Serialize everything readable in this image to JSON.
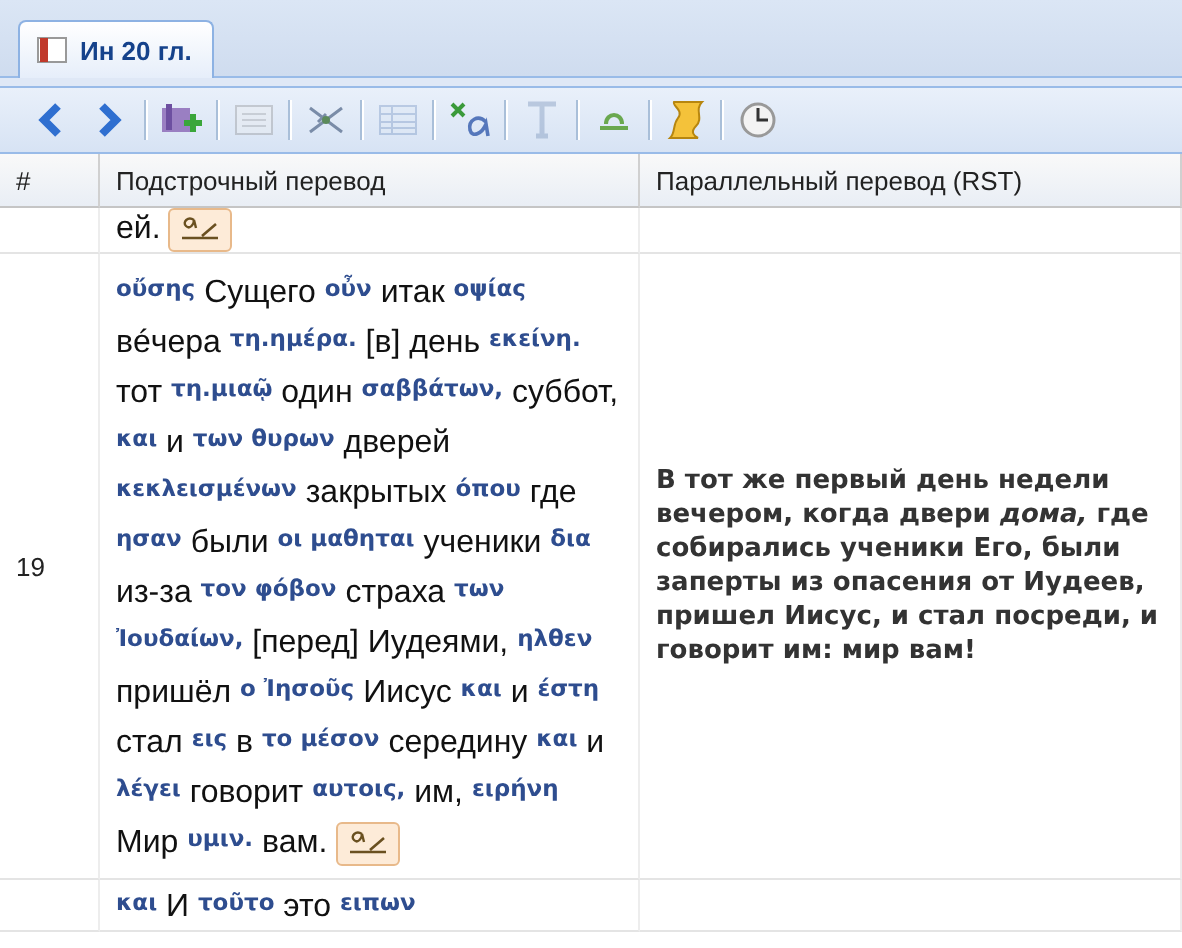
{
  "tabs": [
    {
      "label": "Ин 20 гл.",
      "selected": true
    }
  ],
  "toolbar": [
    {
      "kind": "back",
      "disabled": false
    },
    {
      "kind": "forward",
      "disabled": false
    },
    {
      "kind": "separator"
    },
    {
      "kind": "book-add",
      "disabled": false
    },
    {
      "kind": "separator"
    },
    {
      "kind": "page",
      "disabled": true
    },
    {
      "kind": "separator"
    },
    {
      "kind": "graph",
      "disabled": false
    },
    {
      "kind": "separator"
    },
    {
      "kind": "table",
      "disabled": true
    },
    {
      "kind": "separator"
    },
    {
      "kind": "alpha",
      "disabled": false
    },
    {
      "kind": "separator"
    },
    {
      "kind": "text",
      "disabled": true
    },
    {
      "kind": "separator"
    },
    {
      "kind": "arc",
      "disabled": false
    },
    {
      "kind": "separator"
    },
    {
      "kind": "scroll",
      "disabled": false
    },
    {
      "kind": "separator"
    },
    {
      "kind": "clock",
      "disabled": false
    }
  ],
  "table": {
    "columns": [
      "#",
      "Подстрочный перевод",
      "Параллельный перевод (RST)"
    ],
    "rows": [
      {
        "number": "",
        "tokens": [
          {
            "kind": "russian",
            "text": "ей."
          }
        ],
        "note_icon": true,
        "parallel": ""
      },
      {
        "number": "19",
        "tokens": [
          {
            "kind": "greek",
            "text": "οὔσης"
          },
          {
            "kind": "russian",
            "text": "Сущего"
          },
          {
            "kind": "greek",
            "text": "οὖν"
          },
          {
            "kind": "russian",
            "text": "итак"
          },
          {
            "kind": "greek",
            "text": "οψίας"
          },
          {
            "kind": "russian",
            "text": "вéчера"
          },
          {
            "kind": "greek",
            "text": "τη.ημέρα."
          },
          {
            "kind": "russian",
            "text": "[в] день"
          },
          {
            "kind": "greek",
            "text": "εκείνη."
          },
          {
            "kind": "russian",
            "text": "тот"
          },
          {
            "kind": "greek",
            "text": "τη.μιαῷ"
          },
          {
            "kind": "russian",
            "text": "один"
          },
          {
            "kind": "greek",
            "text": "σαββάτων,"
          },
          {
            "kind": "russian",
            "text": "суббот,"
          },
          {
            "kind": "greek",
            "text": "και"
          },
          {
            "kind": "russian",
            "text": "и"
          },
          {
            "kind": "greek",
            "text": "των θυρων"
          },
          {
            "kind": "russian",
            "text": "дверей"
          },
          {
            "kind": "greek",
            "text": "κεκλεισμένων"
          },
          {
            "kind": "russian",
            "text": "закрытых"
          },
          {
            "kind": "greek",
            "text": "όπου"
          },
          {
            "kind": "russian",
            "text": "где"
          },
          {
            "kind": "greek",
            "text": "ησαν"
          },
          {
            "kind": "russian",
            "text": "были"
          },
          {
            "kind": "greek",
            "text": "οι μαθηται"
          },
          {
            "kind": "russian",
            "text": "ученики"
          },
          {
            "kind": "greek",
            "text": "δια"
          },
          {
            "kind": "russian",
            "text": "из-за"
          },
          {
            "kind": "greek",
            "text": "τον φόβον"
          },
          {
            "kind": "russian",
            "text": "страха"
          },
          {
            "kind": "greek",
            "text": "των Ἰουδαίων,"
          },
          {
            "kind": "russian",
            "text": "[перед] Иудеями,"
          },
          {
            "kind": "greek",
            "text": "ηλθεν"
          },
          {
            "kind": "russian",
            "text": "пришёл"
          },
          {
            "kind": "greek",
            "text": "ο Ἰησοῦς"
          },
          {
            "kind": "russian",
            "text": "Иисус"
          },
          {
            "kind": "greek",
            "text": "και"
          },
          {
            "kind": "russian",
            "text": "и"
          },
          {
            "kind": "greek",
            "text": "έστη"
          },
          {
            "kind": "russian",
            "text": "стал"
          },
          {
            "kind": "greek",
            "text": "εις"
          },
          {
            "kind": "russian",
            "text": "в"
          },
          {
            "kind": "greek",
            "text": "το μέσον"
          },
          {
            "kind": "russian",
            "text": "середину"
          },
          {
            "kind": "greek",
            "text": "και"
          },
          {
            "kind": "russian",
            "text": "и"
          },
          {
            "kind": "greek",
            "text": "λέγει"
          },
          {
            "kind": "russian",
            "text": "говорит"
          },
          {
            "kind": "greek",
            "text": "αυτοις,"
          },
          {
            "kind": "russian",
            "text": "им,"
          },
          {
            "kind": "greek",
            "text": "ειρήνη"
          },
          {
            "kind": "russian",
            "text": "Мир"
          },
          {
            "kind": "greek",
            "text": "υμιν."
          },
          {
            "kind": "russian",
            "text": "вам."
          }
        ],
        "note_icon": true,
        "parallel": "В тот же первый день недели вечером, когда двери *дома,* где собирались ученики Его, были заперты из опасения от Иудеев, пришел Иисус, и стал посреди, и говорит им: мир вам!"
      },
      {
        "number": "",
        "tokens": [
          {
            "kind": "greek",
            "text": "και"
          },
          {
            "kind": "russian",
            "text": "И"
          },
          {
            "kind": "greek",
            "text": "τοῦτο"
          },
          {
            "kind": "russian",
            "text": "это"
          },
          {
            "kind": "greek",
            "text": "ειπων"
          }
        ],
        "note_icon": false,
        "parallel": ""
      }
    ]
  }
}
